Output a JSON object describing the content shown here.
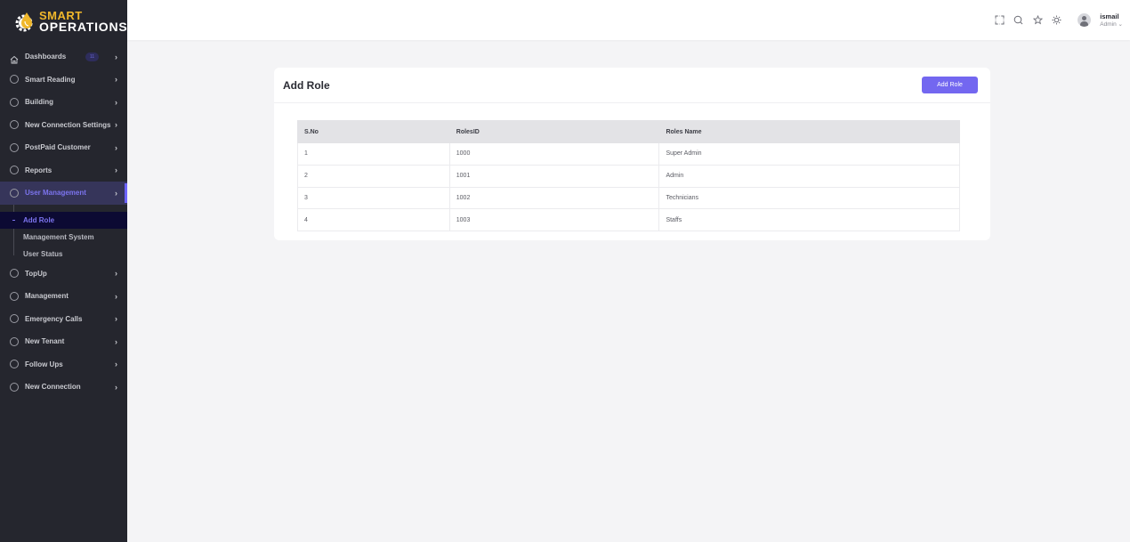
{
  "brand": {
    "line1": "SMART",
    "line2": "OPERATIONS"
  },
  "sidebar": {
    "items": [
      {
        "label": "Dashboards",
        "icon": "home-icon",
        "badge": "11"
      },
      {
        "label": "Smart Reading",
        "icon": "circle-icon"
      },
      {
        "label": "Building",
        "icon": "circle-icon"
      },
      {
        "label": "New Connection Settings",
        "icon": "circle-icon"
      },
      {
        "label": "PostPaid Customer",
        "icon": "circle-icon"
      },
      {
        "label": "Reports",
        "icon": "circle-icon"
      },
      {
        "label": "User Management",
        "icon": "circle-icon",
        "active": true,
        "children": [
          {
            "label": "Add Role",
            "active": true
          },
          {
            "label": "Management System"
          },
          {
            "label": "User Status"
          }
        ]
      },
      {
        "label": "TopUp",
        "icon": "circle-icon"
      },
      {
        "label": "Management",
        "icon": "circle-icon"
      },
      {
        "label": "Emergency Calls",
        "icon": "circle-icon"
      },
      {
        "label": "New Tenant",
        "icon": "circle-icon"
      },
      {
        "label": "Follow Ups",
        "icon": "circle-icon"
      },
      {
        "label": "New Connection",
        "icon": "circle-icon"
      }
    ]
  },
  "header": {
    "icons": [
      "fullscreen-icon",
      "search-icon",
      "star-icon",
      "sun-icon"
    ],
    "user": {
      "name": "ismail",
      "role": "Admin"
    }
  },
  "card": {
    "title": "Add Role",
    "add_button": "Add Role",
    "table": {
      "columns": [
        "S.No",
        "RolesID",
        "Roles Name"
      ],
      "rows": [
        [
          "1",
          "1000",
          "Super Admin"
        ],
        [
          "2",
          "1001",
          "Admin"
        ],
        [
          "3",
          "1002",
          "Technicians"
        ],
        [
          "4",
          "1003",
          "Staffs"
        ]
      ]
    }
  },
  "colors": {
    "accent": "#7367f0",
    "sidebar_bg": "#25262e",
    "brand_yellow": "#f0b72b"
  }
}
